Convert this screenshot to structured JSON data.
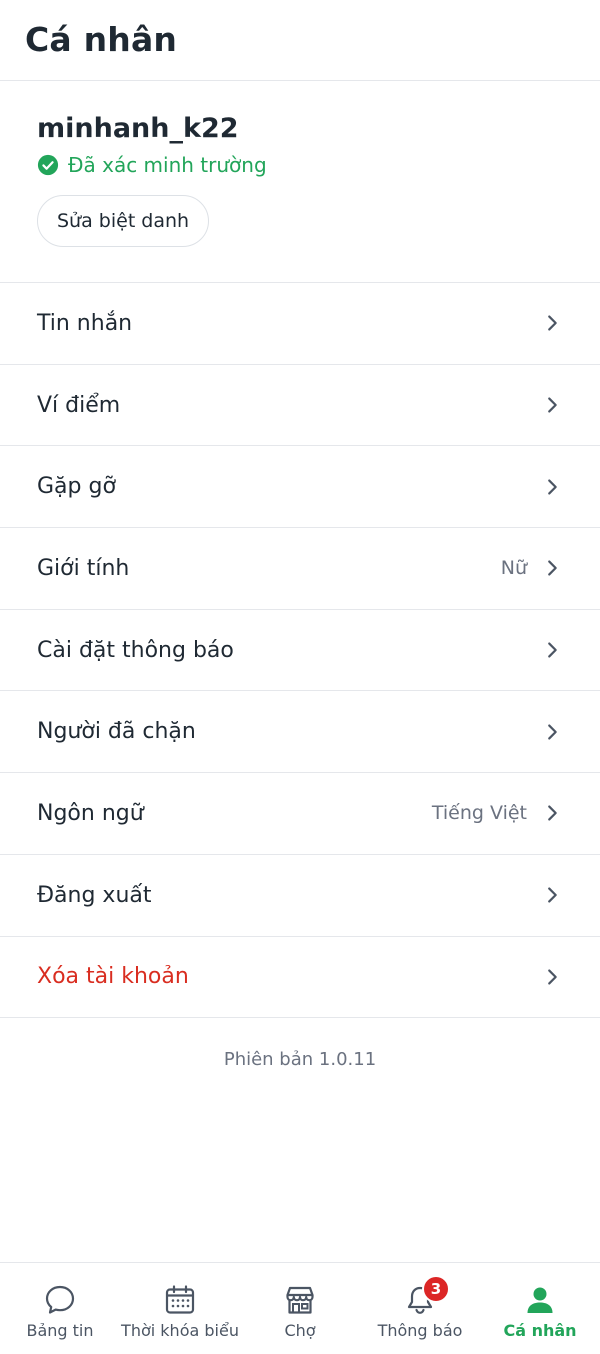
{
  "header": {
    "title": "Cá nhân"
  },
  "profile": {
    "username": "minhanh_k22",
    "verified_text": "Đã xác minh trường",
    "edit_nickname_label": "Sửa biệt danh"
  },
  "menu": [
    {
      "label": "Tin nhắn",
      "value": ""
    },
    {
      "label": "Ví điểm",
      "value": ""
    },
    {
      "label": "Gặp gỡ",
      "value": ""
    },
    {
      "label": "Giới tính",
      "value": "Nữ"
    },
    {
      "label": "Cài đặt thông báo",
      "value": ""
    },
    {
      "label": "Người đã chặn",
      "value": ""
    },
    {
      "label": "Ngôn ngữ",
      "value": "Tiếng Việt"
    },
    {
      "label": "Đăng xuất",
      "value": ""
    },
    {
      "label": "Xóa tài khoản",
      "value": ""
    }
  ],
  "version": "Phiên bản 1.0.11",
  "tabs": [
    {
      "label": "Bảng tin",
      "icon": "chat-bubble-icon"
    },
    {
      "label": "Thời khóa biểu",
      "icon": "calendar-icon"
    },
    {
      "label": "Chợ",
      "icon": "store-icon"
    },
    {
      "label": "Thông báo",
      "icon": "bell-icon",
      "badge": "3"
    },
    {
      "label": "Cá nhân",
      "icon": "person-icon",
      "active": true
    }
  ],
  "colors": {
    "accent": "#22a55a",
    "danger": "#d92d20",
    "badge": "#dc2626",
    "text": "#1f2933",
    "muted": "#6b7280"
  }
}
